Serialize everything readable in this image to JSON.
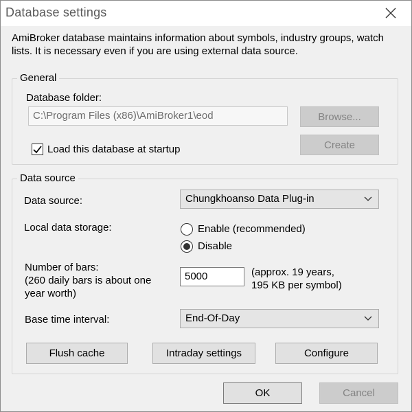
{
  "window": {
    "title": "Database settings",
    "close_icon": "close-icon"
  },
  "info_text": "AmiBroker database maintains information about symbols, industry groups, watch lists. It is necessary even if you are using external data source.",
  "general": {
    "legend": "General",
    "folder_label": "Database folder:",
    "folder_value": "C:\\Program Files (x86)\\AmiBroker1\\eod",
    "browse_label": "Browse...",
    "create_label": "Create",
    "load_at_startup_label": "Load this database at startup",
    "load_at_startup_checked": true
  },
  "data_source": {
    "legend": "Data source",
    "source_label": "Data source:",
    "source_value": "Chungkhoanso Data Plug-in",
    "storage_label": "Local data storage:",
    "enable_label": "Enable (recommended)",
    "disable_label": "Disable",
    "storage_selected": "Disable",
    "bars_label_line1": "Number of bars:",
    "bars_label_line2": "(260 daily bars is about one",
    "bars_label_line3": "year worth)",
    "bars_value": "5000",
    "bars_note_line1": "(approx. 19 years,",
    "bars_note_line2": "195 KB per symbol)",
    "interval_label": "Base time interval:",
    "interval_value": "End-Of-Day",
    "flush_cache_label": "Flush cache",
    "intraday_settings_label": "Intraday settings",
    "configure_label": "Configure"
  },
  "footer": {
    "ok_label": "OK",
    "cancel_label": "Cancel"
  }
}
